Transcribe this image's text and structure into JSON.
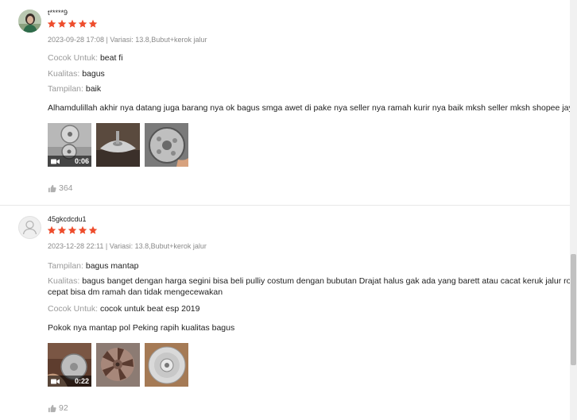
{
  "reviews": [
    {
      "username": "t*****9",
      "rating": 5,
      "meta": "2023-09-28 17:08 | Variasi: 13.8,Bubut+kerok jalur",
      "attributes": [
        {
          "key": "Cocok Untuk:",
          "value": "beat fi"
        },
        {
          "key": "Kualitas:",
          "value": "bagus"
        },
        {
          "key": "Tampilan:",
          "value": "baik"
        }
      ],
      "comment": "Alhamdulillah akhir nya datang juga barang nya ok bagus smga awet di pake nya seller nya ramah kurir nya baik mksh seller mksh shopee jaya",
      "media": [
        {
          "type": "video",
          "duration": "0:06"
        },
        {
          "type": "image"
        },
        {
          "type": "image"
        }
      ],
      "likes": "364"
    },
    {
      "username": "45gkcdcdu1",
      "rating": 5,
      "meta": "2023-12-28 22:11 | Variasi: 13.8,Bubut+kerok jalur",
      "attributes": [
        {
          "key": "Tampilan:",
          "value": "bagus mantap"
        },
        {
          "key": "Kualitas:",
          "value": "bagus banget dengan harga segini bisa beli pulliy costum dengan bubutan Drajat halus gak ada yang barett atau cacat keruk jalur rol",
          "value_line2": "cepat bisa dm ramah dan tidak mengecewakan"
        },
        {
          "key": "Cocok Untuk:",
          "value": "cocok untuk beat esp 2019"
        }
      ],
      "comment": "Pokok nya mantap pol Peking rapih kualitas bagus",
      "media": [
        {
          "type": "video",
          "duration": "0:22"
        },
        {
          "type": "image"
        },
        {
          "type": "image"
        }
      ],
      "likes": "92"
    }
  ],
  "colors": {
    "star": "#ee4d2d",
    "muted": "#8a8a8a",
    "label": "#9a9a9a"
  }
}
